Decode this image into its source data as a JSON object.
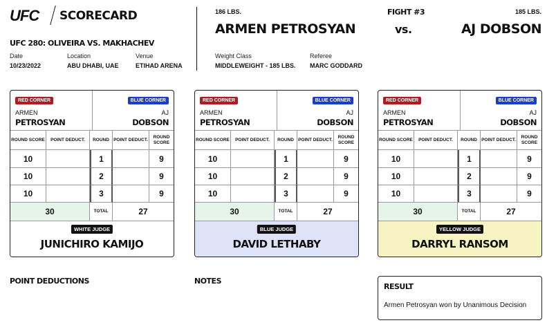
{
  "header": {
    "logo": "UFC",
    "title": "SCORECARD",
    "event": "UFC 280: OLIVEIRA VS. MAKHACHEV",
    "date_label": "Date",
    "date": "10/23/2022",
    "location_label": "Location",
    "location": "ABU DHABI, UAE",
    "venue_label": "Venue",
    "venue": "ETIHAD ARENA"
  },
  "fight": {
    "red_weight": "186 LBS.",
    "red_name": "ARMEN PETROSYAN",
    "number": "FIGHT #3",
    "vs": "vs.",
    "blue_weight": "185 LBS.",
    "blue_name": "AJ DOBSON",
    "weight_class_label": "Weight Class",
    "weight_class": "MIDDLEWEIGHT - 185 LBS.",
    "referee_label": "Referee",
    "referee": "MARC GODDARD"
  },
  "card_labels": {
    "red_corner": "RED CORNER",
    "blue_corner": "BLUE CORNER",
    "red_first": "ARMEN",
    "red_last": "PETROSYAN",
    "blue_first": "AJ",
    "blue_last": "DOBSON",
    "round_score": "ROUND SCORE",
    "point_deduct": "POINT DEDUCT.",
    "round": "ROUND",
    "total": "TOTAL"
  },
  "cards": [
    {
      "judge_label": "WHITE JUDGE",
      "judge": "JUNICHIRO KAMIJO",
      "color": "#ffffff",
      "rounds": [
        {
          "r": "1",
          "red": "10",
          "blue": "9"
        },
        {
          "r": "2",
          "red": "10",
          "blue": "9"
        },
        {
          "r": "3",
          "red": "10",
          "blue": "9"
        }
      ],
      "red_total": "30",
      "blue_total": "27"
    },
    {
      "judge_label": "BLUE JUDGE",
      "judge": "DAVID LETHABY",
      "color": "#dfe3f9",
      "rounds": [
        {
          "r": "1",
          "red": "10",
          "blue": "9"
        },
        {
          "r": "2",
          "red": "10",
          "blue": "9"
        },
        {
          "r": "3",
          "red": "10",
          "blue": "9"
        }
      ],
      "red_total": "30",
      "blue_total": "27"
    },
    {
      "judge_label": "YELLOW JUDGE",
      "judge": "DARRYL RANSOM",
      "color": "#f8f3c2",
      "rounds": [
        {
          "r": "1",
          "red": "10",
          "blue": "9"
        },
        {
          "r": "2",
          "red": "10",
          "blue": "9"
        },
        {
          "r": "3",
          "red": "10",
          "blue": "9"
        }
      ],
      "red_total": "30",
      "blue_total": "27"
    }
  ],
  "footer": {
    "point_deductions": "POINT DEDUCTIONS",
    "notes": "NOTES",
    "result_title": "RESULT",
    "result_text": "Armen Petrosyan won by Unanimous Decision"
  },
  "colors": {
    "winner_total_bg": "#e6f5ea",
    "red_badge": "#b01b22",
    "blue_badge": "#1a3ccf"
  }
}
